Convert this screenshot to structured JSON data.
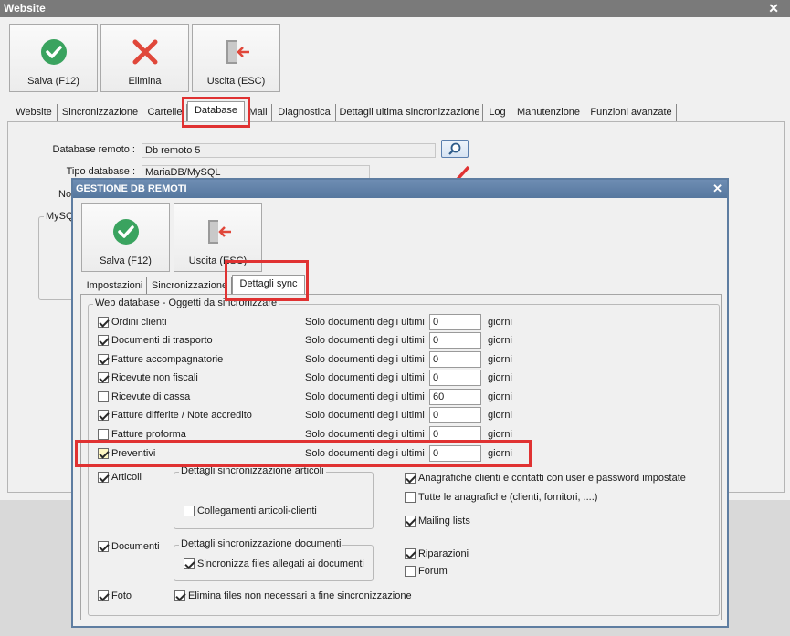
{
  "outer": {
    "title": "Website",
    "toolbar": {
      "save": "Salva (F12)",
      "delete": "Elimina",
      "exit": "Uscita (ESC)"
    },
    "tabs": [
      "Website",
      "Sincronizzazione",
      "Cartelle",
      "Database",
      "Mail",
      "Diagnostica",
      "Dettagli ultima sincronizzazione",
      "Log",
      "Manutenzione",
      "Funzioni avanzate"
    ],
    "active_tab": "Database",
    "fields": {
      "db_remote_label": "Database remoto :",
      "db_remote_value": "Db remoto 5",
      "db_type_label": "Tipo database :",
      "db_type_value": "MariaDB/MySQL",
      "name_label_partial": "Nor",
      "mysql_group_partial": "MySQ"
    }
  },
  "dialog": {
    "title": "GESTIONE DB REMOTI",
    "toolbar": {
      "save": "Salva (F12)",
      "exit": "Uscita (ESC)"
    },
    "tabs": [
      "Impostazioni",
      "Sincronizzazione",
      "Dettagli sync"
    ],
    "active_tab": "Dettagli sync",
    "group_title": "Web database - Oggetti da sincronizzare",
    "prefix_text": "Solo documenti degli ultimi",
    "suffix_text": "giorni",
    "objects": [
      {
        "label": "Ordini clienti",
        "checked": true,
        "days": "0"
      },
      {
        "label": "Documenti di trasporto",
        "checked": true,
        "days": "0"
      },
      {
        "label": "Fatture accompagnatorie",
        "checked": true,
        "days": "0"
      },
      {
        "label": "Ricevute non fiscali",
        "checked": true,
        "days": "0"
      },
      {
        "label": "Ricevute di cassa",
        "checked": false,
        "days": "60"
      },
      {
        "label": "Fatture differite / Note accredito",
        "checked": true,
        "days": "0"
      },
      {
        "label": "Fatture proforma",
        "checked": false,
        "days": "0"
      },
      {
        "label": "Preventivi",
        "checked": true,
        "days": "0"
      }
    ],
    "articoli": {
      "label": "Articoli",
      "checked": true,
      "group_title": "Dettagli sincronizzazione articoli",
      "option": {
        "label": "Collegamenti articoli-clienti",
        "checked": false
      }
    },
    "documenti": {
      "label": "Documenti",
      "checked": true,
      "group_title": "Dettagli sincronizzazione documenti",
      "option": {
        "label": "Sincronizza files allegati ai documenti",
        "checked": true
      }
    },
    "foto": {
      "label": "Foto",
      "checked": true,
      "option": {
        "label": "Elimina files non necessari a fine sincronizzazione",
        "checked": true
      }
    },
    "right_options": [
      {
        "label": "Anagrafiche clienti e contatti con user e password impostate",
        "checked": true
      },
      {
        "label": "Tutte le anagrafiche (clienti, fornitori, ....)",
        "checked": false
      },
      {
        "label": "Mailing lists",
        "checked": true
      },
      {
        "label": "Riparazioni",
        "checked": true
      },
      {
        "label": "Forum",
        "checked": false
      }
    ]
  },
  "colors": {
    "highlight": "#e03232",
    "check_icon": "#3aa35f",
    "delete_icon": "#e0473a",
    "exit_icon": "#e0473a"
  },
  "icons": [
    "check-circle-icon",
    "x-icon",
    "exit-door-icon",
    "search-icon",
    "close-icon"
  ]
}
